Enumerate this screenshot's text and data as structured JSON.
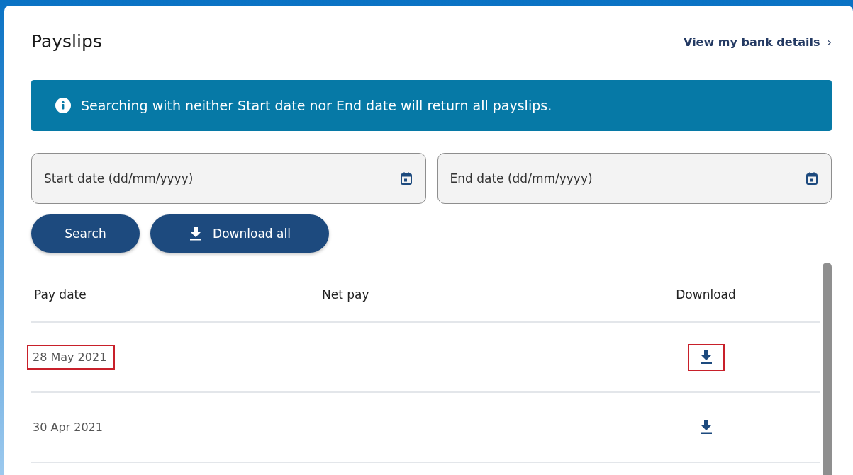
{
  "header": {
    "title": "Payslips",
    "link": "View my bank details",
    "link_chevron": "›"
  },
  "banner": {
    "message": "Searching with neither Start date nor End date will return all payslips."
  },
  "filters": [
    {
      "placeholder": "Start date (dd/mm/yyyy)"
    },
    {
      "placeholder": "End date (dd/mm/yyyy)"
    }
  ],
  "buttons": [
    {
      "label": "Search",
      "kind": "plain"
    },
    {
      "label": "Download all",
      "kind": "download"
    }
  ],
  "table": {
    "columns": [
      "Pay date",
      "Net pay",
      "Download"
    ],
    "rows": [
      {
        "pay_date": "28 May 2021",
        "highlighted": true
      },
      {
        "pay_date": "30 Apr 2021",
        "highlighted": false
      }
    ]
  }
}
